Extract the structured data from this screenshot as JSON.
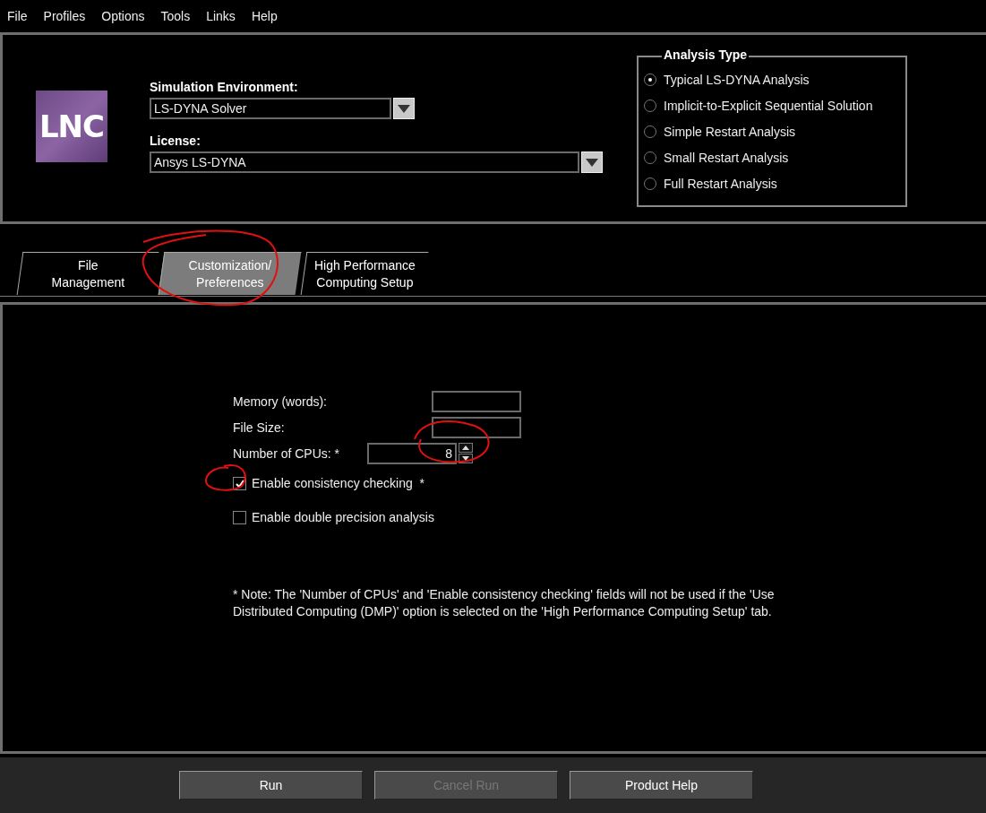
{
  "menu": [
    "File",
    "Profiles",
    "Options",
    "Tools",
    "Links",
    "Help"
  ],
  "logo": {
    "text": "LNC"
  },
  "simulation_environment": {
    "label": "Simulation Environment:",
    "value": "LS-DYNA Solver"
  },
  "license": {
    "label": "License:",
    "value": "Ansys LS-DYNA"
  },
  "analysis_type": {
    "title": "Analysis Type",
    "options": [
      {
        "label": "Typical LS-DYNA Analysis",
        "selected": true
      },
      {
        "label": "Implicit-to-Explicit Sequential Solution",
        "selected": false
      },
      {
        "label": "Simple Restart Analysis",
        "selected": false
      },
      {
        "label": "Small Restart Analysis",
        "selected": false
      },
      {
        "label": "Full Restart Analysis",
        "selected": false
      }
    ]
  },
  "tabs": [
    {
      "label": "File\nManagement",
      "selected": false
    },
    {
      "label": "Customization/\nPreferences",
      "selected": true
    },
    {
      "label": "High Performance\nComputing Setup",
      "selected": false
    }
  ],
  "fields": [
    {
      "label": "Memory (words):"
    },
    {
      "label": "File Size:"
    }
  ],
  "cpus": {
    "label": "Number of CPUs: *",
    "value": "8"
  },
  "checkboxes": [
    {
      "label": "Enable consistency checking  *",
      "checked": true
    },
    {
      "label": "Enable double precision analysis",
      "checked": false
    }
  ],
  "note": "*  Note: The 'Number of CPUs' and 'Enable consistency checking' fields will not be used if the 'Use Distributed Computing (DMP)' option is selected on the 'High Performance Computing Setup' tab.",
  "buttons": [
    {
      "label": "Run",
      "disabled": false
    },
    {
      "label": "Cancel Run",
      "disabled": true
    },
    {
      "label": "Product Help",
      "disabled": false
    }
  ]
}
